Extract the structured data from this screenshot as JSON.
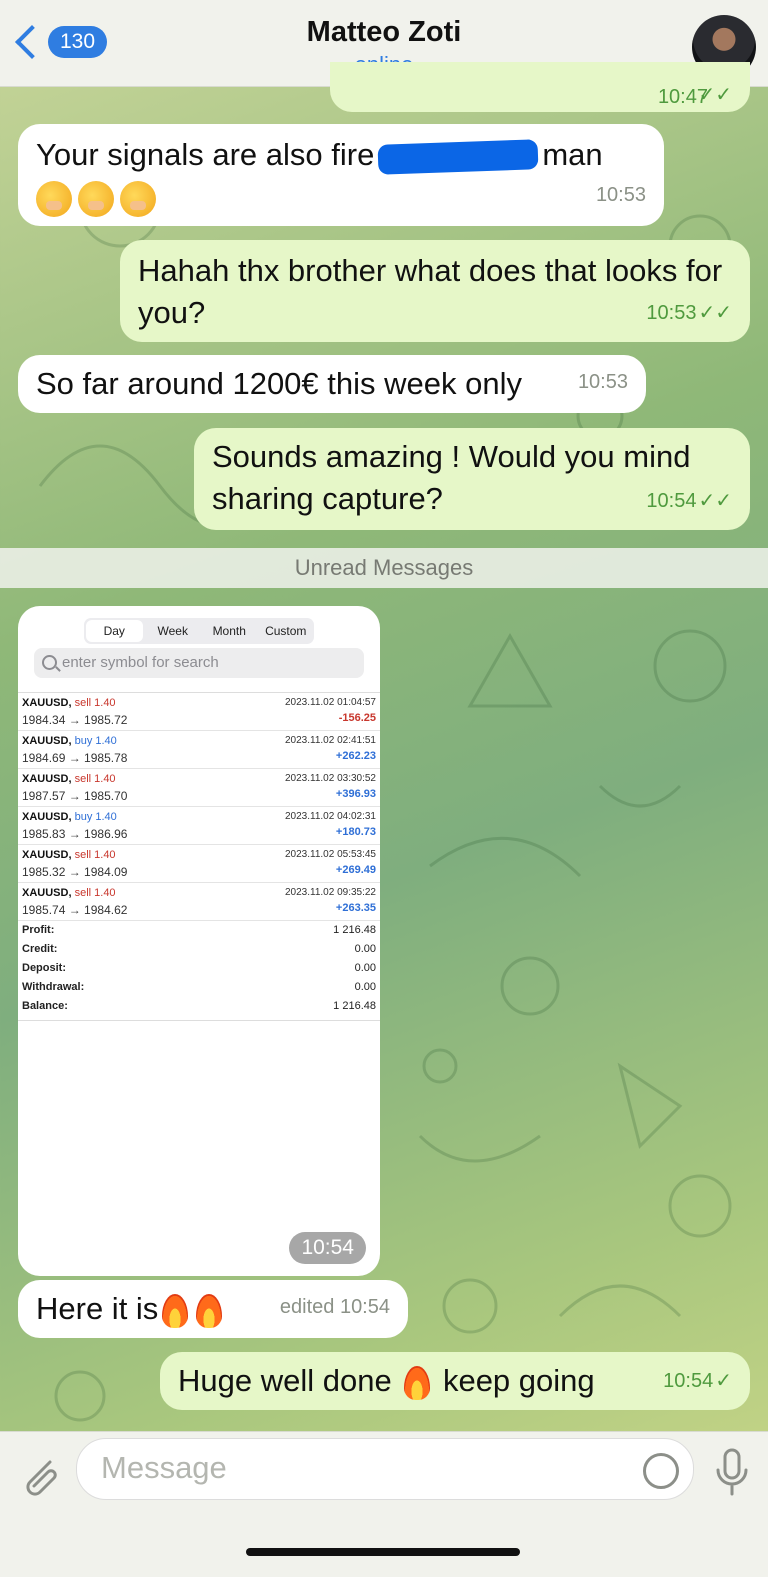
{
  "header": {
    "back_count": "130",
    "contact_name": "Matteo Zoti",
    "status": "online"
  },
  "messages": [
    {
      "text_a": "Your signals are also fire",
      "text_b": "man",
      "time": "10:53"
    },
    {
      "text": "Hahah thx brother what does that looks for you?",
      "time": "10:53"
    },
    {
      "text": "So far around 1200€ this week only",
      "time": "10:53"
    },
    {
      "text": "Sounds amazing ! Would you mind sharing capture?",
      "time": "10:54"
    },
    {
      "text": "Here it is",
      "time": "edited 10:54"
    },
    {
      "text_a": "Huge well done",
      "text_b": "keep going",
      "time": "10:54"
    }
  ],
  "top_partial_time": "10:47",
  "divider": "Unread Messages",
  "screenshot": {
    "tabs": [
      "Day",
      "Week",
      "Month",
      "Custom"
    ],
    "active_tab": "Day",
    "search_placeholder": "enter symbol for search",
    "trades": [
      {
        "symbol": "XAUUSD,",
        "side": "sell 1.40",
        "prices": "1984.34 → 1985.72",
        "datetime": "2023.11.02 01:04:57",
        "pl": "-156.25"
      },
      {
        "symbol": "XAUUSD,",
        "side": "buy 1.40",
        "prices": "1984.69 → 1985.78",
        "datetime": "2023.11.02 02:41:51",
        "pl": "+262.23"
      },
      {
        "symbol": "XAUUSD,",
        "side": "sell 1.40",
        "prices": "1987.57 → 1985.70",
        "datetime": "2023.11.02 03:30:52",
        "pl": "+396.93"
      },
      {
        "symbol": "XAUUSD,",
        "side": "buy 1.40",
        "prices": "1985.83 → 1986.96",
        "datetime": "2023.11.02 04:02:31",
        "pl": "+180.73"
      },
      {
        "symbol": "XAUUSD,",
        "side": "sell 1.40",
        "prices": "1985.32 → 1984.09",
        "datetime": "2023.11.02 05:53:45",
        "pl": "+269.49"
      },
      {
        "symbol": "XAUUSD,",
        "side": "sell 1.40",
        "prices": "1985.74 → 1984.62",
        "datetime": "2023.11.02 09:35:22",
        "pl": "+263.35"
      }
    ],
    "summary": [
      {
        "label": "Profit:",
        "value": "1 216.48"
      },
      {
        "label": "Credit:",
        "value": "0.00"
      },
      {
        "label": "Deposit:",
        "value": "0.00"
      },
      {
        "label": "Withdrawal:",
        "value": "0.00"
      },
      {
        "label": "Balance:",
        "value": "1 216.48"
      }
    ],
    "time": "10:54"
  },
  "input": {
    "placeholder": "Message"
  },
  "colors": {
    "accent": "#2f7de1",
    "sell": "#c8372d",
    "buy": "#2f6fd6",
    "outgoing_bubble": "#e6f7c8"
  }
}
